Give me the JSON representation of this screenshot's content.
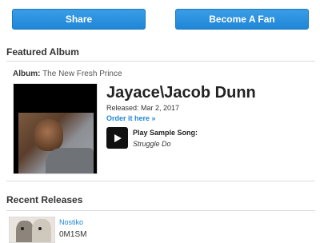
{
  "actions": {
    "share_label": "Share",
    "fan_label": "Become A Fan"
  },
  "featured": {
    "section_title": "Featured Album",
    "album_label": "Album:",
    "album_name": "The New Fresh Prince",
    "artist": "Jayace\\Jacob Dunn",
    "released": "Released: Mar 2, 2017",
    "order_link": "Order it here »",
    "sample_label": "Play Sample Song:",
    "sample_song": "Struggle Do"
  },
  "recent": {
    "section_title": "Recent Releases",
    "items": [
      {
        "artist": "Nostiko",
        "title": "0M1SM"
      }
    ]
  },
  "colors": {
    "accent": "#1f86d6",
    "button_text": "#ffffff",
    "divider": "#dddddd"
  },
  "icons": {
    "play": "play-icon"
  }
}
